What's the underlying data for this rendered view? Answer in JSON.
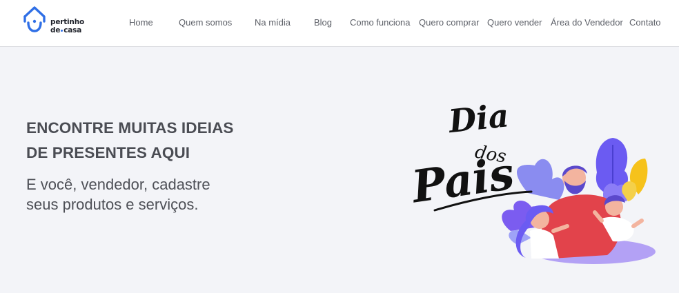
{
  "brand": {
    "line1": "pertinho",
    "line2_a": "de",
    "line2_b": "casa",
    "color": "#2f6fe6"
  },
  "nav": {
    "home": "Home",
    "quem_somos": "Quem somos",
    "na_midia": "Na mídia",
    "blog": "Blog",
    "como_funciona": "Como funciona",
    "quero_comprar": "Quero comprar",
    "quero_vender": "Quero vender",
    "area_vendedor": "Área do Vendedor",
    "contato": "Contato"
  },
  "hero": {
    "title_line1": "ENCONTRE MUITAS IDEIAS",
    "title_line2": "DE PRESENTES AQUI",
    "subtitle_line1": "E você, vendedor, cadastre",
    "subtitle_line2": "seus produtos e serviços."
  },
  "banner": {
    "word1": "Dia",
    "word2": "dos",
    "word3": "Pais",
    "icon": "family-illustration"
  }
}
